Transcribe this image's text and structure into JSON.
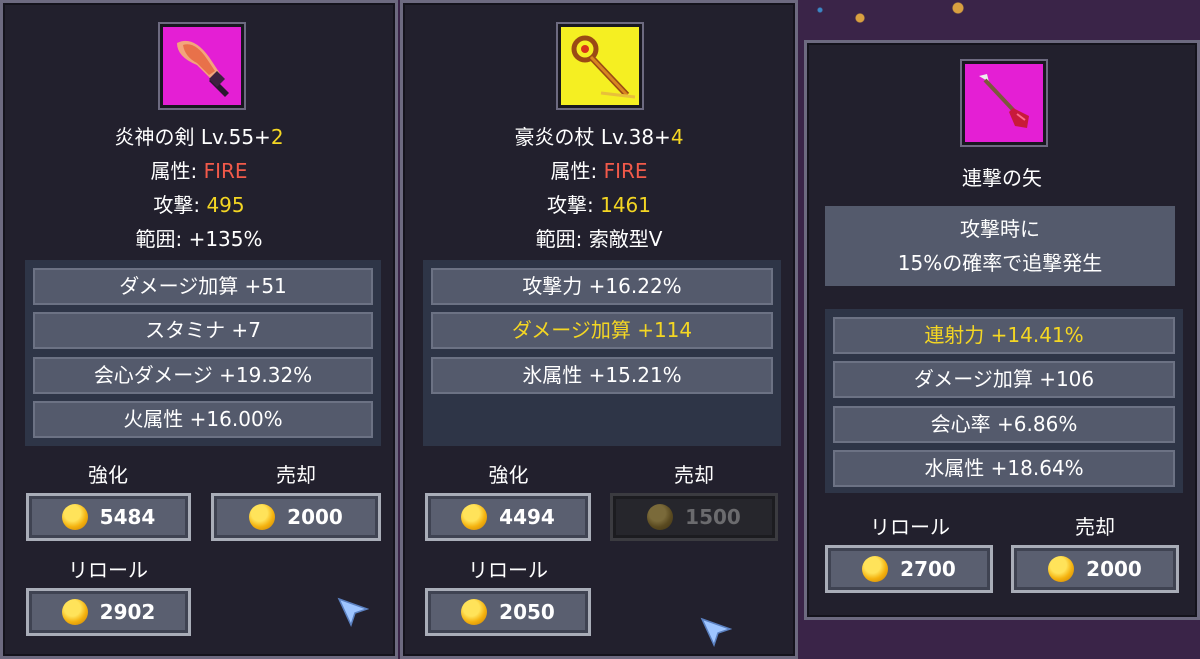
{
  "panels": [
    {
      "name": "炎神の剣",
      "level": "Lv.55+",
      "plus": "2",
      "attr_label": "属性: ",
      "attr_value": "FIRE",
      "atk_label": "攻撃: ",
      "atk_value": "495",
      "range": "範囲: +135%",
      "stats": [
        "ダメージ加算 +51",
        "スタミナ +7",
        "会心ダメージ +19.32%",
        "火属性 +16.00%"
      ],
      "enhance_label": "強化",
      "enhance_cost": "5484",
      "sell_label": "売却",
      "sell_price": "2000",
      "reroll_label": "リロール",
      "reroll_cost": "2902"
    },
    {
      "name": "豪炎の杖",
      "level": "Lv.38+",
      "plus": "4",
      "attr_label": "属性: ",
      "attr_value": "FIRE",
      "atk_label": "攻撃: ",
      "atk_value": "1461",
      "range": "範囲: 索敵型V",
      "stats": [
        "攻撃力 +16.22%",
        "ダメージ加算 +114",
        "氷属性 +15.21%"
      ],
      "highlighted_stat": 1,
      "enhance_label": "強化",
      "enhance_cost": "4494",
      "sell_label": "売却",
      "sell_price": "1500",
      "reroll_label": "リロール",
      "reroll_cost": "2050"
    },
    {
      "name": "連撃の矢",
      "description": [
        "攻撃時に",
        "15%の確率で追撃発生"
      ],
      "stats": [
        "連射力 +14.41%",
        "ダメージ加算 +106",
        "会心率 +6.86%",
        "水属性 +18.64%"
      ],
      "highlighted_stat": 0,
      "reroll_label": "リロール",
      "reroll_cost": "2700",
      "sell_label": "売却",
      "sell_price": "2000"
    }
  ],
  "colors": {
    "fire": "#f25a4a",
    "gold": "#f4d623",
    "panel": "#22202d"
  },
  "icons": [
    "flame-sword-icon",
    "fire-staff-icon",
    "arrow-icon",
    "gold-coin-icon",
    "cursor-arrow-icon"
  ]
}
